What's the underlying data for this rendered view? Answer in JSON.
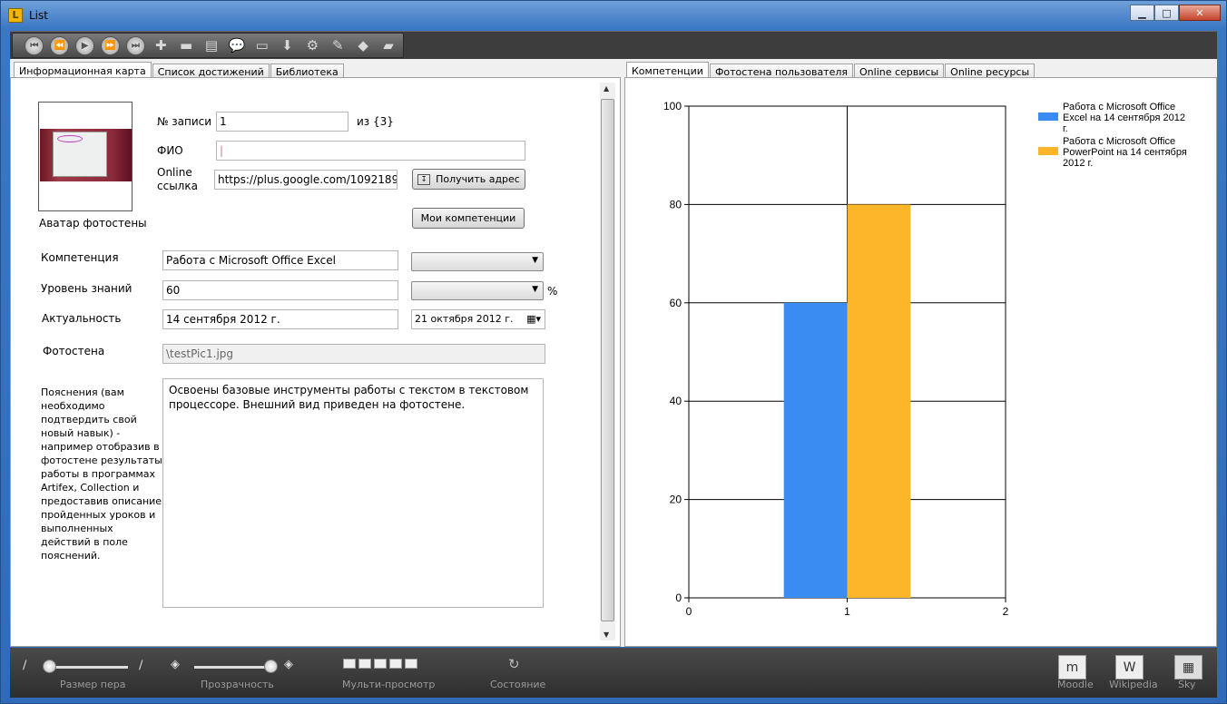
{
  "window": {
    "title": "List"
  },
  "left_tabs": [
    "Информационная карта",
    "Список достижений",
    "Библиотека"
  ],
  "right_tabs": [
    "Компетенции",
    "Фотостена пользователя",
    "Online сервисы",
    "Online ресурсы"
  ],
  "avatar": {
    "caption": "Аватар фотостены"
  },
  "record": {
    "label": "№ записи",
    "value": "1",
    "of": "из {3}"
  },
  "fio": {
    "label": "ФИО",
    "value": "|"
  },
  "online": {
    "label": "Online ссылка",
    "value": "https://plus.google.com/10921897",
    "button": "Получить адрес"
  },
  "my_competencies_button": "Мои компетенции",
  "competency": {
    "label": "Компетенция",
    "value": "Работа с Microsoft Office Excel",
    "combo": ""
  },
  "knowledge": {
    "label": "Уровень знаний",
    "value": "60",
    "combo": "",
    "unit": "%"
  },
  "actuality": {
    "label": "Актуальность",
    "value": "14 сентября 2012 г.",
    "date": "21 октября  2012 г."
  },
  "photowall": {
    "label": "Фотостена",
    "value": "\\testPic1.jpg"
  },
  "explanation": {
    "label": "Пояснения (вам необходимо подтвердить свой новый навык) - например отобразив в фотостене результаты работы в программах Artifex, Collection и предоставив описание пройденных уроков и выполненных действий в поле пояснений.",
    "value": "Освоены базовые инструменты работы с текстом в текстовом процессоре. Внешний вид приведен на фотостене."
  },
  "toolbar_icons": [
    "first-icon",
    "prev-icon",
    "play-icon",
    "next-icon",
    "last-icon",
    "add-icon",
    "remove-icon",
    "document-icon",
    "comment-icon",
    "image-icon",
    "download-icon",
    "settings-icon",
    "pen-icon",
    "eraser-icon",
    "folder-icon"
  ],
  "statusbar": {
    "pen_size": "Размер пера",
    "transparency": "Прозрачность",
    "multiview": "Мульти-просмотр",
    "state": "Состояние",
    "moodle": "Moodle",
    "wikipedia": "Wikipedia",
    "sky": "Sky",
    "pen_size_level": 0.0,
    "transparency_level": 1.0
  },
  "chart_data": {
    "type": "bar",
    "x": [
      0.8,
      1.2
    ],
    "xlim": [
      0,
      2
    ],
    "xticks": [
      0,
      1,
      2
    ],
    "ylim": [
      0,
      100
    ],
    "yticks": [
      0,
      20,
      40,
      60,
      80,
      100
    ],
    "grid": true,
    "legend_position": "top-right",
    "series": [
      {
        "name": "Работа с Microsoft Office Excel на 14 сентября 2012 г.",
        "values": [
          60
        ],
        "color": "#3b8cf2"
      },
      {
        "name": "Работа с Microsoft Office PowerPoint на 14 сентября 2012 г.",
        "values": [
          80
        ],
        "color": "#fdb52a"
      }
    ]
  }
}
